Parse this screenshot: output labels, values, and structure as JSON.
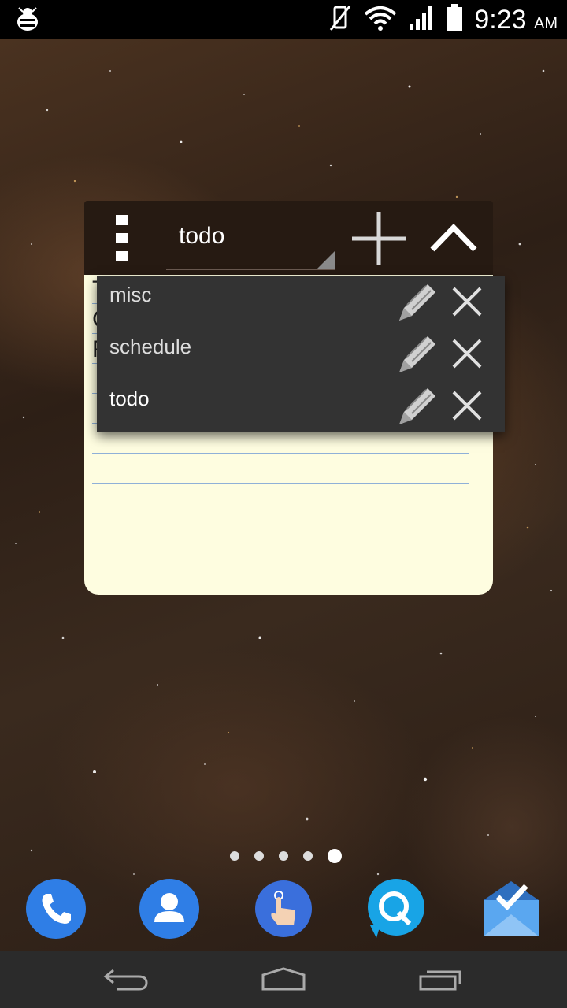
{
  "status_bar": {
    "time": "9:23",
    "am_pm": "AM",
    "icons": [
      "debug-icon",
      "mute-vibrate-icon",
      "wifi-icon",
      "signal-icon",
      "battery-icon"
    ]
  },
  "widget": {
    "menu_icon": "overflow-menu-icon",
    "selected_list": "todo",
    "add_icon": "plus-icon",
    "collapse_icon": "chevron-up-icon",
    "note_partial_lines": [
      "T",
      "C",
      "F"
    ]
  },
  "dropdown": {
    "items": [
      {
        "label": "misc",
        "edit_icon": "pencil-icon",
        "delete_icon": "close-icon"
      },
      {
        "label": "schedule",
        "edit_icon": "pencil-icon",
        "delete_icon": "close-icon"
      },
      {
        "label": "todo",
        "edit_icon": "pencil-icon",
        "delete_icon": "close-icon"
      }
    ]
  },
  "home": {
    "page_count": 5,
    "active_page": 5,
    "dock": [
      "phone-icon",
      "contacts-icon",
      "gesture-app-icon",
      "q-chat-icon",
      "inbox-icon"
    ]
  },
  "nav_bar": [
    "back-icon",
    "home-icon",
    "recents-icon"
  ],
  "colors": {
    "header_bg": "#261a12",
    "paper_bg": "#fefde0",
    "dropdown_bg": "#333333",
    "rule_line": "#8fb0d8"
  }
}
